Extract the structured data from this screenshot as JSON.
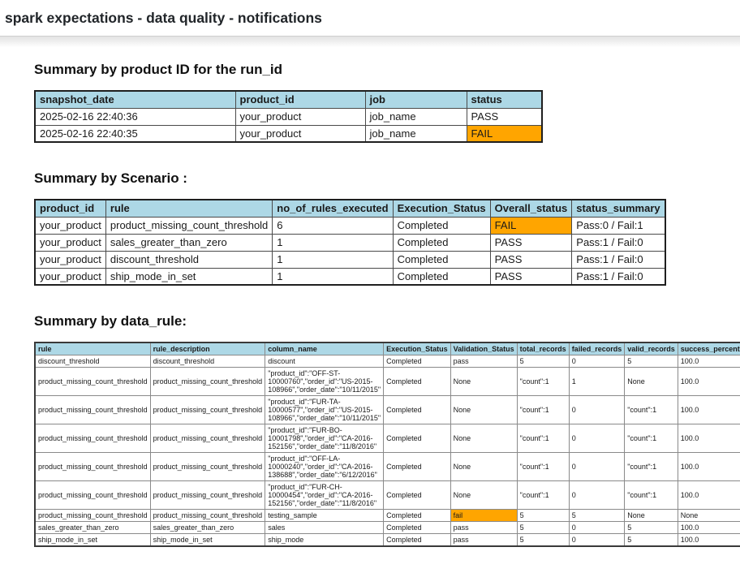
{
  "page": {
    "title": "spark expectations - data quality - notifications"
  },
  "colors": {
    "table_header_bg": "#ADD8E6",
    "fail_bg": "#FFA500",
    "pass_text": "#1a1a1a"
  },
  "fail_values": [
    "FAIL",
    "fail"
  ],
  "sections": [
    {
      "heading": "Summary by product ID for the run_id",
      "columns": [
        "snapshot_date",
        "product_id",
        "job",
        "status"
      ],
      "rows": [
        [
          "2025-02-16 22:40:36",
          "your_product",
          "job_name",
          "PASS"
        ],
        [
          "2025-02-16 22:40:35",
          "your_product",
          "job_name",
          "FAIL"
        ]
      ]
    },
    {
      "heading": "Summary by Scenario :",
      "columns": [
        "product_id",
        "rule",
        "no_of_rules_executed",
        "Execution_Status",
        "Overall_status",
        "status_summary"
      ],
      "rows": [
        [
          "your_product",
          "product_missing_count_threshold",
          "6",
          "Completed",
          "FAIL",
          "Pass:0 / Fail:1"
        ],
        [
          "your_product",
          "sales_greater_than_zero",
          "1",
          "Completed",
          "PASS",
          "Pass:1 / Fail:0"
        ],
        [
          "your_product",
          "discount_threshold",
          "1",
          "Completed",
          "PASS",
          "Pass:1 / Fail:0"
        ],
        [
          "your_product",
          "ship_mode_in_set",
          "1",
          "Completed",
          "PASS",
          "Pass:1 / Fail:0"
        ]
      ]
    },
    {
      "heading": "Summary by data_rule:",
      "columns": [
        "rule",
        "rule_description",
        "column_name",
        "Execution_Status",
        "Validation_Status",
        "total_records",
        "failed_records",
        "valid_records",
        "success_percentage"
      ],
      "rows": [
        [
          "discount_threshold",
          "discount_threshold",
          "discount",
          "Completed",
          "pass",
          "5",
          "0",
          "5",
          "100.0"
        ],
        [
          "product_missing_count_threshold",
          "product_missing_count_threshold",
          "\"product_id\":\"OFF-ST-10000760\",\"order_id\":\"US-2015-108966\",\"order_date\":\"10/11/2015\"",
          "Completed",
          "None",
          "\"count\":1",
          "1",
          "None",
          "100.0"
        ],
        [
          "product_missing_count_threshold",
          "product_missing_count_threshold",
          "\"product_id\":\"FUR-TA-10000577\",\"order_id\":\"US-2015-108966\",\"order_date\":\"10/11/2015\"",
          "Completed",
          "None",
          "\"count\":1",
          "0",
          "\"count\":1",
          "100.0"
        ],
        [
          "product_missing_count_threshold",
          "product_missing_count_threshold",
          "\"product_id\":\"FUR-BO-10001798\",\"order_id\":\"CA-2016-152156\",\"order_date\":\"11/8/2016\"",
          "Completed",
          "None",
          "\"count\":1",
          "0",
          "\"count\":1",
          "100.0"
        ],
        [
          "product_missing_count_threshold",
          "product_missing_count_threshold",
          "\"product_id\":\"OFF-LA-10000240\",\"order_id\":\"CA-2016-138688\",\"order_date\":\"6/12/2016\"",
          "Completed",
          "None",
          "\"count\":1",
          "0",
          "\"count\":1",
          "100.0"
        ],
        [
          "product_missing_count_threshold",
          "product_missing_count_threshold",
          "\"product_id\":\"FUR-CH-10000454\",\"order_id\":\"CA-2016-152156\",\"order_date\":\"11/8/2016\"",
          "Completed",
          "None",
          "\"count\":1",
          "0",
          "\"count\":1",
          "100.0"
        ],
        [
          "product_missing_count_threshold",
          "product_missing_count_threshold",
          "testing_sample",
          "Completed",
          "fail",
          "5",
          "5",
          "None",
          "None"
        ],
        [
          "sales_greater_than_zero",
          "sales_greater_than_zero",
          "sales",
          "Completed",
          "pass",
          "5",
          "0",
          "5",
          "100.0"
        ],
        [
          "ship_mode_in_set",
          "ship_mode_in_set",
          "ship_mode",
          "Completed",
          "pass",
          "5",
          "0",
          "5",
          "100.0"
        ]
      ]
    }
  ]
}
